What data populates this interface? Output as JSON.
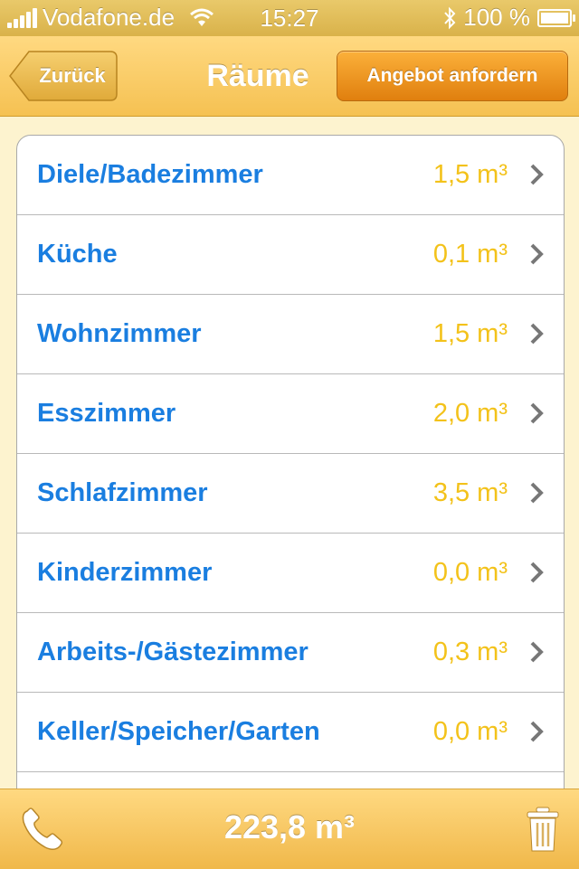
{
  "status_bar": {
    "carrier": "Vodafone.de",
    "time": "15:27",
    "battery": "100 %"
  },
  "nav": {
    "back_label": "Zurück",
    "title": "Räume",
    "offer_label": "Angebot anfordern"
  },
  "rooms": [
    {
      "name": "Diele/Badezimmer",
      "volume": "1,5 m³"
    },
    {
      "name": "Küche",
      "volume": "0,1 m³"
    },
    {
      "name": "Wohnzimmer",
      "volume": "1,5 m³"
    },
    {
      "name": "Esszimmer",
      "volume": "2,0 m³"
    },
    {
      "name": "Schlafzimmer",
      "volume": "3,5 m³"
    },
    {
      "name": "Kinderzimmer",
      "volume": "0,0 m³"
    },
    {
      "name": "Arbeits-/Gästezimmer",
      "volume": "0,3 m³"
    },
    {
      "name": "Keller/Speicher/Garten",
      "volume": "0,0 m³"
    },
    {
      "name": "",
      "volume": ""
    }
  ],
  "bottom": {
    "total": "223,8  m³"
  },
  "icons": {
    "phone": "phone-icon",
    "trash": "trash-icon",
    "chevron": "chevron-right-icon"
  },
  "colors": {
    "accent_orange": "#f08f16",
    "bar_yellow": "#f5c152",
    "room_name_blue": "#1a7ee0",
    "volume_yellow": "#f3c21a"
  }
}
